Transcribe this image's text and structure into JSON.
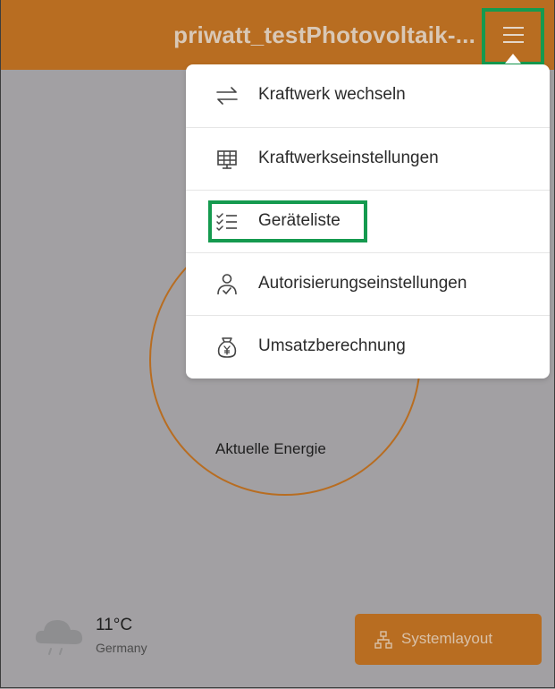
{
  "header": {
    "title": "priwatt_testPhotovoltaik-...",
    "menu_icon": "hamburger-menu-icon"
  },
  "menu": {
    "items": [
      {
        "label": "Kraftwerk wechseln",
        "icon": "switch-arrows-icon"
      },
      {
        "label": "Kraftwerkseinstellungen",
        "icon": "solar-panel-icon"
      },
      {
        "label": "Geräteliste",
        "icon": "checklist-icon",
        "highlighted": true
      },
      {
        "label": "Autorisierungseinstellungen",
        "icon": "user-authorization-icon"
      },
      {
        "label": "Umsatzberechnung",
        "icon": "money-bag-icon"
      }
    ]
  },
  "main": {
    "energy_label": "Aktuelle Energie"
  },
  "weather": {
    "temperature": "11°C",
    "location": "Germany",
    "icon": "rain-cloud-icon"
  },
  "system_layout_button": {
    "label": "Systemlayout",
    "icon": "hierarchy-icon"
  },
  "colors": {
    "brand": "#b86d21",
    "overlay_background": "#a2a0a3",
    "highlight_border": "#159a4f",
    "menu_background": "#ffffff"
  }
}
